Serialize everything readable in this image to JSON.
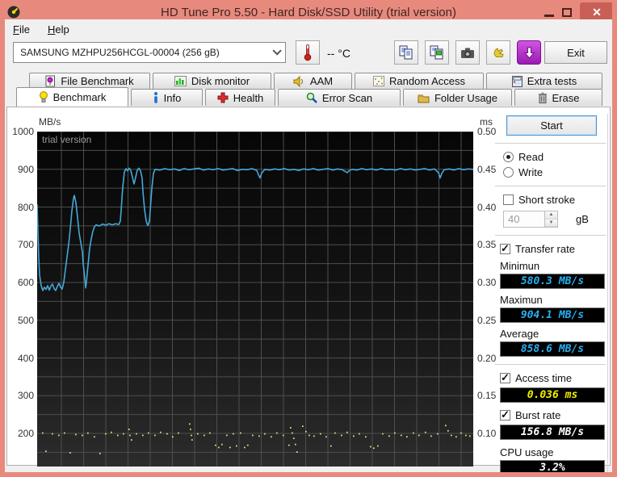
{
  "window": {
    "title": "HD Tune Pro 5.50 - Hard Disk/SSD Utility (trial version)",
    "close_glyph": "✕"
  },
  "menu": {
    "items": [
      {
        "hotkey": "F",
        "rest": "ile"
      },
      {
        "hotkey": "H",
        "rest": "elp"
      }
    ]
  },
  "toolbar": {
    "drive_select_value": "SAMSUNG MZHPU256HCGL-00004 (256 gB)",
    "temperature": "-- °C",
    "exit_label": "Exit",
    "icons": [
      "thermometer-icon",
      "copy-text-icon",
      "copy-image-icon",
      "screenshot-icon",
      "donate-icon",
      "update-icon"
    ]
  },
  "tabs": {
    "row1": [
      {
        "label": "File Benchmark"
      },
      {
        "label": "Disk monitor"
      },
      {
        "label": "AAM"
      },
      {
        "label": "Random Access"
      },
      {
        "label": "Extra tests"
      }
    ],
    "row2": [
      {
        "label": "Benchmark",
        "active": true
      },
      {
        "label": "Info"
      },
      {
        "label": "Health"
      },
      {
        "label": "Error Scan"
      },
      {
        "label": "Folder Usage"
      },
      {
        "label": "Erase"
      }
    ]
  },
  "side_panel": {
    "start_label": "Start",
    "read_label": "Read",
    "write_label": "Write",
    "mode_read_selected": true,
    "mode_write_selected": false,
    "short_stroke_label": "Short stroke",
    "short_stroke_checked": false,
    "stroke_size_value": "40",
    "stroke_size_unit": "gB",
    "transfer_rate_label": "Transfer rate",
    "transfer_rate_checked": true,
    "minimum_label": "Minimun",
    "minimum_value": "580.3 MB/s",
    "maximum_label": "Maximun",
    "maximum_value": "904.1 MB/s",
    "average_label": "Average",
    "average_value": "858.6 MB/s",
    "access_time_label": "Access time",
    "access_time_checked": true,
    "access_time_value": "0.036 ms",
    "burst_rate_label": "Burst rate",
    "burst_rate_checked": true,
    "burst_rate_value": "156.8 MB/s",
    "cpu_usage_label": "CPU usage",
    "cpu_usage_value": "3.2%"
  },
  "chart_data": {
    "type": "line",
    "watermark": "trial version",
    "grid": true,
    "left_axis": {
      "unit": "MB/s",
      "ticks": [
        "1000",
        "900",
        "800",
        "700",
        "600",
        "500",
        "400",
        "300",
        "200"
      ],
      "top_value": 1000,
      "tick_step": 100
    },
    "right_axis": {
      "unit": "ms",
      "ticks": [
        "0.50",
        "0.45",
        "0.40",
        "0.35",
        "0.30",
        "0.25",
        "0.20",
        "0.15",
        "0.10"
      ],
      "top_value": 0.5,
      "tick_step": 0.05
    },
    "summary": {
      "minimum_mbs": 580.3,
      "maximum_mbs": 904.1,
      "average_mbs": 858.6,
      "access_time_ms": 0.036,
      "burst_rate_mbs": 156.8,
      "cpu_usage_pct": 3.2
    },
    "series": [
      {
        "name": "transfer-rate",
        "unit": "MB/s",
        "color": "#45a8d8",
        "style": "line",
        "points": [
          [
            0,
            806
          ],
          [
            1,
            735
          ],
          [
            2,
            665
          ],
          [
            3,
            620
          ],
          [
            5,
            592
          ],
          [
            7,
            579
          ],
          [
            9,
            588
          ],
          [
            11,
            582
          ],
          [
            13,
            592
          ],
          [
            15,
            580
          ],
          [
            17,
            591
          ],
          [
            19,
            596
          ],
          [
            21,
            584
          ],
          [
            23,
            579
          ],
          [
            25,
            590
          ],
          [
            27,
            598
          ],
          [
            29,
            588
          ],
          [
            31,
            583
          ],
          [
            33,
            601
          ],
          [
            35,
            634
          ],
          [
            37,
            668
          ],
          [
            39,
            701
          ],
          [
            41,
            742
          ],
          [
            43,
            790
          ],
          [
            45,
            823
          ],
          [
            46,
            831
          ],
          [
            48,
            812
          ],
          [
            50,
            773
          ],
          [
            52,
            731
          ],
          [
            54,
            706
          ],
          [
            56,
            681
          ],
          [
            57,
            651
          ],
          [
            59,
            611
          ],
          [
            60,
            586
          ],
          [
            61,
            601
          ],
          [
            63,
            646
          ],
          [
            65,
            691
          ],
          [
            67,
            716
          ],
          [
            69,
            736
          ],
          [
            71,
            748
          ],
          [
            73,
            753
          ],
          [
            77,
            750
          ],
          [
            81,
            755
          ],
          [
            85,
            752
          ],
          [
            89,
            756
          ],
          [
            93,
            753
          ],
          [
            97,
            756
          ],
          [
            101,
            754
          ],
          [
            103,
            763
          ],
          [
            104,
            791
          ],
          [
            106,
            853
          ],
          [
            108,
            893
          ],
          [
            110,
            902
          ],
          [
            112,
            896
          ],
          [
            114,
            903
          ],
          [
            116,
            897
          ],
          [
            118,
            879
          ],
          [
            120,
            861
          ],
          [
            122,
            879
          ],
          [
            124,
            898
          ],
          [
            126,
            903
          ],
          [
            128,
            896
          ],
          [
            130,
            876
          ],
          [
            131,
            841
          ],
          [
            133,
            794
          ],
          [
            135,
            763
          ],
          [
            137,
            751
          ],
          [
            139,
            763
          ],
          [
            140,
            791
          ],
          [
            142,
            849
          ],
          [
            144,
            889
          ],
          [
            146,
            900
          ],
          [
            152,
            898
          ],
          [
            158,
            902
          ],
          [
            164,
            899
          ],
          [
            170,
            901
          ],
          [
            176,
            897
          ],
          [
            182,
            902
          ],
          [
            188,
            899
          ],
          [
            194,
            901
          ],
          [
            200,
            903
          ],
          [
            206,
            898
          ],
          [
            212,
            901
          ],
          [
            218,
            899
          ],
          [
            224,
            902
          ],
          [
            230,
            898
          ],
          [
            236,
            900
          ],
          [
            242,
            902
          ],
          [
            248,
            897
          ],
          [
            254,
            900
          ],
          [
            260,
            899
          ],
          [
            266,
            902
          ],
          [
            272,
            897
          ],
          [
            274,
            886
          ],
          [
            276,
            877
          ],
          [
            278,
            890
          ],
          [
            282,
            900
          ],
          [
            288,
            898
          ],
          [
            294,
            901
          ],
          [
            300,
            899
          ],
          [
            306,
            902
          ],
          [
            312,
            898
          ],
          [
            318,
            900
          ],
          [
            324,
            897
          ],
          [
            330,
            901
          ],
          [
            336,
            899
          ],
          [
            342,
            902
          ],
          [
            348,
            898
          ],
          [
            354,
            900
          ],
          [
            360,
            902
          ],
          [
            366,
            898
          ],
          [
            372,
            901
          ],
          [
            378,
            899
          ],
          [
            384,
            891
          ],
          [
            386,
            896
          ],
          [
            390,
            900
          ],
          [
            396,
            898
          ],
          [
            402,
            902
          ],
          [
            408,
            899
          ],
          [
            414,
            901
          ],
          [
            420,
            898
          ],
          [
            426,
            902
          ],
          [
            432,
            899
          ],
          [
            438,
            900
          ],
          [
            444,
            898
          ],
          [
            450,
            902
          ],
          [
            456,
            899
          ],
          [
            462,
            901
          ],
          [
            468,
            898
          ],
          [
            474,
            900
          ],
          [
            480,
            902
          ],
          [
            486,
            898
          ],
          [
            492,
            901
          ],
          [
            497,
            891
          ],
          [
            499,
            877
          ],
          [
            501,
            889
          ],
          [
            504,
            899
          ],
          [
            510,
            901
          ],
          [
            516,
            898
          ],
          [
            522,
            902
          ],
          [
            528,
            899
          ],
          [
            534,
            901
          ],
          [
            540,
            900
          ]
        ]
      },
      {
        "name": "access-time",
        "unit": "ms",
        "color": "#e9e87c",
        "style": "dots",
        "points": [
          [
            6,
            0.103
          ],
          [
            10,
            0.079
          ],
          [
            18,
            0.102
          ],
          [
            26,
            0.1
          ],
          [
            33,
            0.103
          ],
          [
            40,
            0.077
          ],
          [
            47,
            0.101
          ],
          [
            55,
            0.1
          ],
          [
            62,
            0.103
          ],
          [
            70,
            0.098
          ],
          [
            77,
            0.076
          ],
          [
            84,
            0.102
          ],
          [
            91,
            0.104
          ],
          [
            99,
            0.1
          ],
          [
            106,
            0.102
          ],
          [
            113,
            0.108
          ],
          [
            114,
            0.1
          ],
          [
            116,
            0.094
          ],
          [
            122,
            0.102
          ],
          [
            130,
            0.1
          ],
          [
            137,
            0.103
          ],
          [
            145,
            0.1
          ],
          [
            152,
            0.104
          ],
          [
            160,
            0.102
          ],
          [
            167,
            0.098
          ],
          [
            174,
            0.103
          ],
          [
            188,
            0.115
          ],
          [
            189,
            0.108
          ],
          [
            190,
            0.1
          ],
          [
            191,
            0.094
          ],
          [
            198,
            0.102
          ],
          [
            206,
            0.1
          ],
          [
            213,
            0.103
          ],
          [
            220,
            0.087
          ],
          [
            224,
            0.084
          ],
          [
            228,
            0.088
          ],
          [
            234,
            0.1
          ],
          [
            238,
            0.084
          ],
          [
            242,
            0.102
          ],
          [
            246,
            0.086
          ],
          [
            251,
            0.103
          ],
          [
            256,
            0.084
          ],
          [
            260,
            0.087
          ],
          [
            266,
            0.1
          ],
          [
            274,
            0.099
          ],
          [
            281,
            0.102
          ],
          [
            289,
            0.098
          ],
          [
            296,
            0.103
          ],
          [
            304,
            0.1
          ],
          [
            311,
            0.087
          ],
          [
            313,
            0.11
          ],
          [
            315,
            0.103
          ],
          [
            317,
            0.096
          ],
          [
            319,
            0.088
          ],
          [
            321,
            0.078
          ],
          [
            328,
            0.112
          ],
          [
            332,
            0.105
          ],
          [
            336,
            0.1
          ],
          [
            342,
            0.099
          ],
          [
            350,
            0.102
          ],
          [
            357,
            0.098
          ],
          [
            363,
            0.086
          ],
          [
            368,
            0.103
          ],
          [
            376,
            0.1
          ],
          [
            383,
            0.104
          ],
          [
            391,
            0.099
          ],
          [
            398,
            0.102
          ],
          [
            406,
            0.098
          ],
          [
            412,
            0.085
          ],
          [
            416,
            0.083
          ],
          [
            421,
            0.086
          ],
          [
            427,
            0.102
          ],
          [
            435,
            0.099
          ],
          [
            442,
            0.103
          ],
          [
            450,
            0.1
          ],
          [
            457,
            0.098
          ],
          [
            465,
            0.103
          ],
          [
            472,
            0.1
          ],
          [
            480,
            0.104
          ],
          [
            487,
            0.099
          ],
          [
            495,
            0.102
          ],
          [
            505,
            0.113
          ],
          [
            508,
            0.106
          ],
          [
            512,
            0.1
          ],
          [
            518,
            0.098
          ],
          [
            524,
            0.103
          ],
          [
            530,
            0.1
          ],
          [
            535,
            0.099
          ]
        ]
      }
    ]
  }
}
